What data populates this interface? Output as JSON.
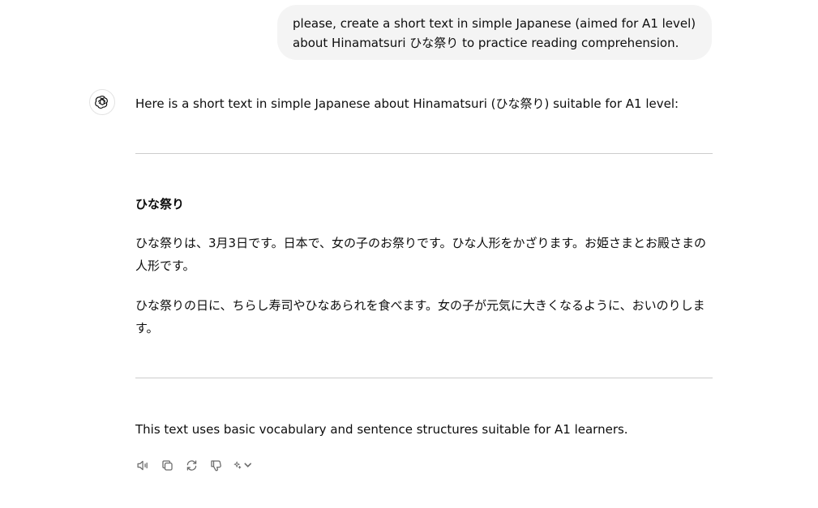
{
  "user_message": {
    "line1": "please, create a short text in simple Japanese (aimed for A1 level)",
    "line2": "about Hinamatsuri ひな祭り to practice reading comprehension."
  },
  "assistant_message": {
    "avatar_icon": "openai-logo-icon",
    "intro": "Here is a short text in simple Japanese about Hinamatsuri (ひな祭り) suitable for A1 level:",
    "heading": "ひな祭り",
    "paragraphs": [
      "ひな祭りは、3月3日です。日本で、女の子のお祭りです。ひな人形をかざります。お姫さまとお殿さまの人形です。",
      "ひな祭りの日に、ちらし寿司やひなあられを食べます。女の子が元気に大きくなるように、おいのりします。"
    ],
    "note": "This text uses basic vocabulary and sentence structures suitable for A1 learners."
  },
  "actions": [
    {
      "icon": "speaker-icon"
    },
    {
      "icon": "copy-icon"
    },
    {
      "icon": "regenerate-icon"
    },
    {
      "icon": "thumbs-down-icon"
    },
    {
      "icon": "sparkle-model-icon"
    }
  ],
  "colors": {
    "bubble_bg": "#f4f4f4",
    "text": "#0d0d0d",
    "divider": "#cdcdcd",
    "icon": "#6b6b6b"
  }
}
